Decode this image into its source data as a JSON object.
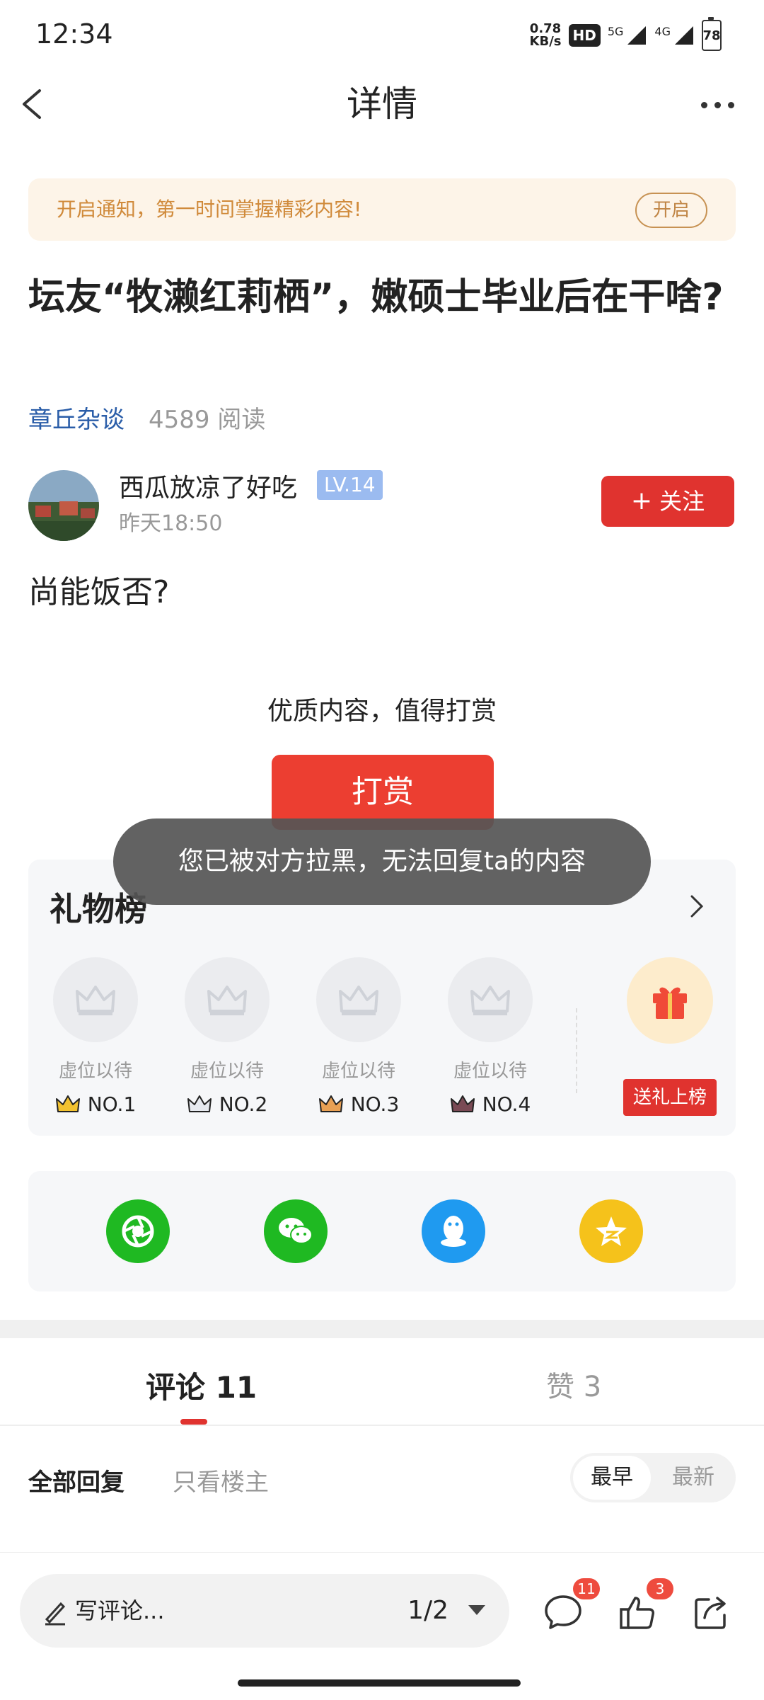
{
  "status_bar": {
    "time": "12:34",
    "net_speed_value": "0.78",
    "net_speed_unit": "KB/s",
    "hd_label": "HD",
    "signal_1_label": "5G",
    "signal_2_label": "4G",
    "battery_level": "78"
  },
  "nav": {
    "title": "详情"
  },
  "notice": {
    "text": "开启通知，第一时间掌握精彩内容!",
    "button": "开启"
  },
  "post": {
    "title": "坛友“牧濑红莉栖”，嫩硕士毕业后在干啥?",
    "forum": "章丘杂谈",
    "read_count": "4589 阅读",
    "author_name": "西瓜放凉了好吃",
    "author_level": "LV.14",
    "time": "昨天18:50",
    "follow_button": "关注",
    "body": "尚能饭否?"
  },
  "reward": {
    "prompt": "优质内容，值得打赏",
    "button": "打赏"
  },
  "toast": {
    "text": "您已被对方拉黑，无法回复ta的内容"
  },
  "gift_board": {
    "title": "礼物榜",
    "slots": [
      {
        "label": "虚位以待",
        "rank": "NO.1",
        "crown_color": "#f2c230"
      },
      {
        "label": "虚位以待",
        "rank": "NO.2",
        "crown_color": "#c9ced8"
      },
      {
        "label": "虚位以待",
        "rank": "NO.3",
        "crown_color": "#e8a054"
      },
      {
        "label": "虚位以待",
        "rank": "NO.4",
        "crown_color": "#7a4a55"
      }
    ],
    "send_button": "送礼上榜"
  },
  "share": {
    "items": [
      {
        "name": "moments",
        "color": "#1fb922"
      },
      {
        "name": "wechat",
        "color": "#1fb922"
      },
      {
        "name": "qq",
        "color": "#1f9af0"
      },
      {
        "name": "qzone",
        "color": "#f5c21b"
      }
    ]
  },
  "tabs": {
    "comments": "评论 11",
    "likes": "赞 3"
  },
  "filters": {
    "all": "全部回复",
    "owner_only": "只看楼主",
    "sort_earliest": "最早",
    "sort_latest": "最新"
  },
  "bottom_bar": {
    "placeholder": "写评论...",
    "page": "1/2",
    "comment_count": "11",
    "like_count": "3"
  },
  "colors": {
    "accent_red": "#e0332f",
    "link_blue": "#2a5da8",
    "notice_bg": "#fdf4e8",
    "notice_text": "#d08a3a"
  }
}
